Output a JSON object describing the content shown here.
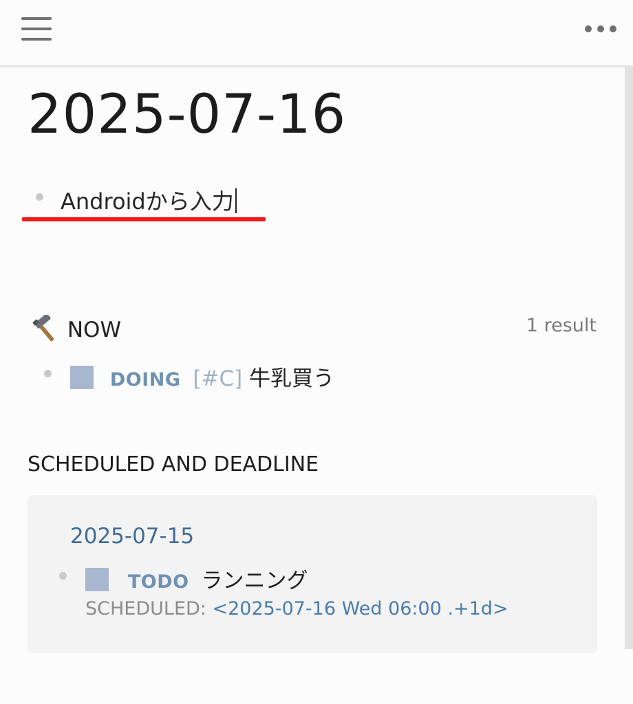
{
  "header": {
    "menu_icon": "hamburger-menu-icon",
    "more_icon": "more-horizontal-icon"
  },
  "page": {
    "title": "2025-07-16",
    "block_text": "Androidから入力",
    "annotation_color": "#f01818"
  },
  "now": {
    "icon": "hammer-icon",
    "title": "NOW",
    "result_count": "1 result",
    "tasks": [
      {
        "marker": "DOING",
        "priority": "[#C]",
        "text": "牛乳買う"
      }
    ]
  },
  "scheduled": {
    "title": "SCHEDULED AND DEADLINE",
    "groups": [
      {
        "date": "2025-07-15",
        "tasks": [
          {
            "marker": "TODO",
            "text": "ランニング",
            "scheduled_label": "SCHEDULED:",
            "scheduled_value": "<2025-07-16 Wed 06:00 .+1d>"
          }
        ]
      }
    ]
  },
  "colors": {
    "marker": "#6f92b3",
    "checkbox": "#a7b7cf",
    "link": "#3f6c96"
  }
}
